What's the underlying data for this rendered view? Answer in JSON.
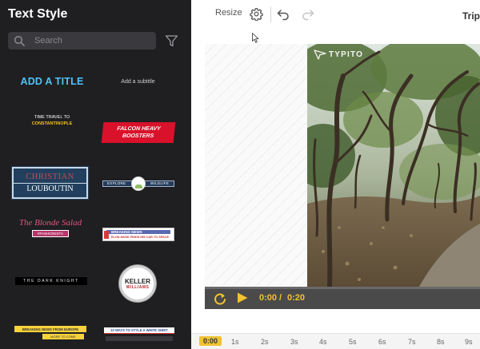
{
  "sidebar": {
    "title": "Text Style",
    "search_placeholder": "Search",
    "tiles": {
      "add_title": "ADD A TITLE",
      "add_subtitle": "Add a subtitle",
      "time_travel_line1": "TIME TRAVEL TO",
      "time_travel_line2": "CONSTANTINOPLE",
      "falcon_line1": "FALCON HEAVY",
      "falcon_line2": "BOOSTERS",
      "christian_line1": "CHRISTIAN",
      "christian_line2": "LOUBOUTIN",
      "explore_left": "EXPLORE",
      "explore_right": "WILDLIFE",
      "blonde_line1": "The Blonde Salad",
      "blonde_line2": "#FASHIONISTA",
      "breaking_line1": "BREAKING NEWS",
      "breaking_line2": "ELON MUSK FINDS HIS CAR TO SPACE",
      "dark_knight": "THE DARK KNIGHT",
      "keller_line1": "KELLER",
      "keller_line2": "WILLIAMS",
      "yellow_line1": "BREAKING NEWS FROM EUROPE",
      "yellow_line2": "MORE TO COME",
      "ways_line1": "10 WAYS TO STYLE A WHITE SHIRT"
    }
  },
  "toolbar": {
    "resize_label": "Resize",
    "project_title": "Trip"
  },
  "canvas": {
    "watermark": "TYPITO"
  },
  "player": {
    "time_current": "0:00",
    "time_separator": "/",
    "time_total": "0:20",
    "progress": 0
  },
  "timeline": {
    "ticks": [
      "0:00",
      "1s",
      "2s",
      "3s",
      "4s",
      "5s",
      "6s",
      "7s",
      "8s",
      "9s"
    ]
  },
  "colors": {
    "sidebar_bg": "#1f1f22",
    "accent": "#f2c233",
    "player_bg": "#4a4a4a"
  },
  "icons": [
    "search-icon",
    "filter-icon",
    "gear-icon",
    "undo-icon",
    "redo-icon",
    "replay-icon",
    "play-icon",
    "typito-logo-icon"
  ]
}
